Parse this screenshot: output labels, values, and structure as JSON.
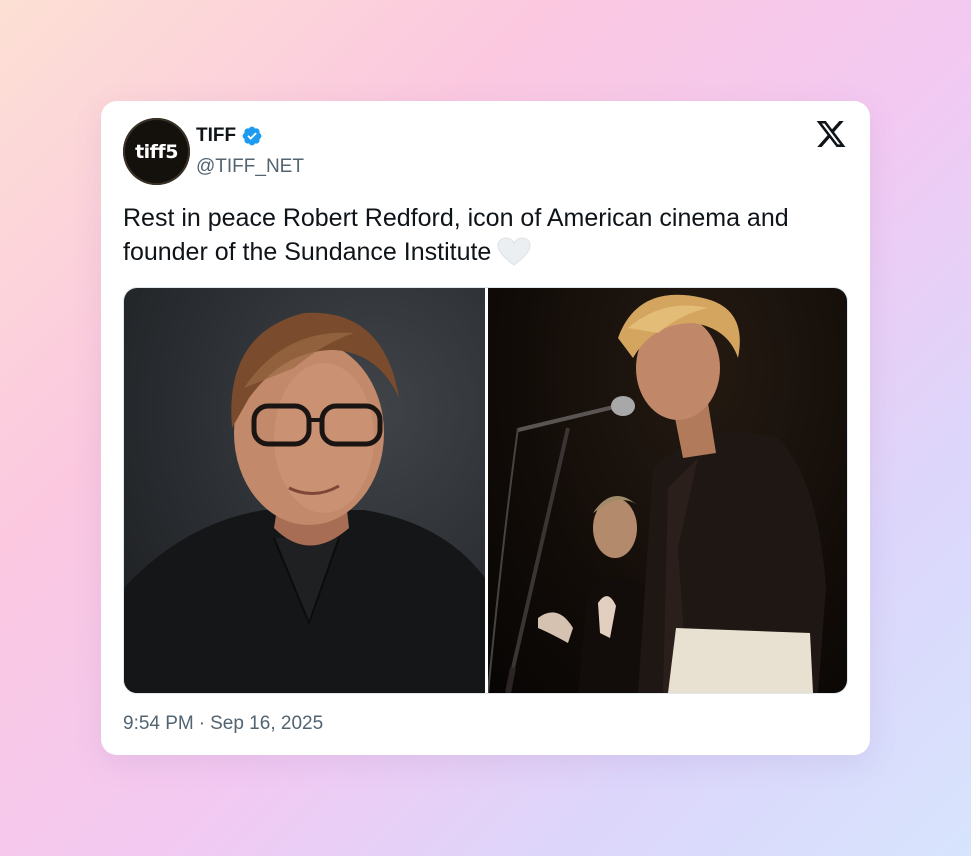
{
  "tweet": {
    "author": {
      "display_name": "TIFF",
      "handle": "@TIFF_NET",
      "avatar_text": "tiff5",
      "verified": true,
      "verified_color": "#1d9bf0"
    },
    "platform_icon": "x-logo-icon",
    "text": "Rest in peace Robert Redford, icon of American cinema and founder of the Sundance Institute",
    "emoji": "white-heart-icon",
    "media": [
      {
        "kind": "photo",
        "subject": "portrait-photo"
      },
      {
        "kind": "photo",
        "subject": "stage-microphone-photo"
      }
    ],
    "time": "9:54 PM",
    "separator": "·",
    "date": "Sep 16, 2025"
  },
  "colors": {
    "text_primary": "#0f1419",
    "text_secondary": "#536471",
    "verified_blue": "#1d9bf0"
  }
}
